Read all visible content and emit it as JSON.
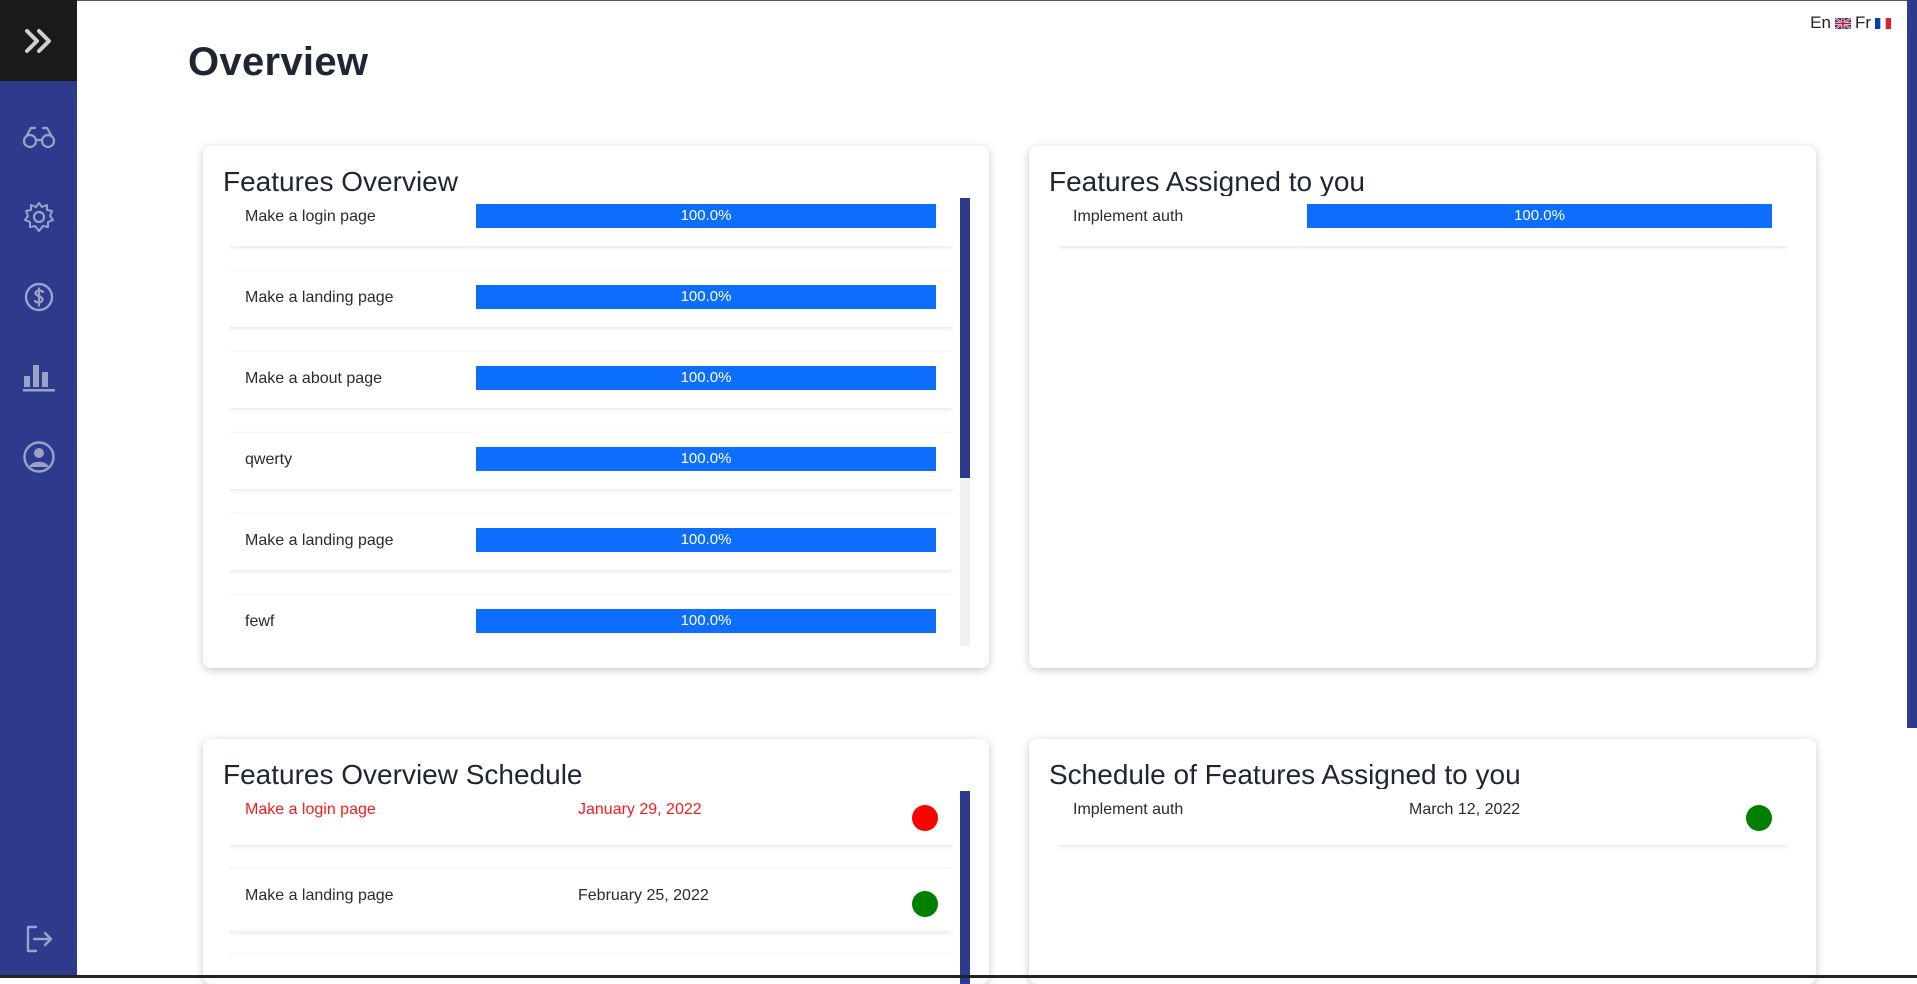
{
  "page": {
    "title": "Overview"
  },
  "language": {
    "en_label": "En",
    "fr_label": "Fr"
  },
  "sidebar": {
    "toggle_icon": "double-chevron-right-icon",
    "items": [
      {
        "icon": "binoculars-icon"
      },
      {
        "icon": "gear-icon"
      },
      {
        "icon": "dollar-circle-icon"
      },
      {
        "icon": "bar-chart-icon"
      },
      {
        "icon": "user-circle-icon"
      }
    ],
    "logout_icon": "logout-icon"
  },
  "features_overview": {
    "title": "Features Overview",
    "items": [
      {
        "name": "Make a login page",
        "progress": 100,
        "progress_label": "100.0%"
      },
      {
        "name": "Make a landing page",
        "progress": 100,
        "progress_label": "100.0%"
      },
      {
        "name": "Make a about page",
        "progress": 100,
        "progress_label": "100.0%"
      },
      {
        "name": "qwerty",
        "progress": 100,
        "progress_label": "100.0%"
      },
      {
        "name": "Make a landing page",
        "progress": 100,
        "progress_label": "100.0%"
      },
      {
        "name": "fewf",
        "progress": 100,
        "progress_label": "100.0%"
      }
    ]
  },
  "features_assigned": {
    "title": "Features Assigned to you",
    "items": [
      {
        "name": "Implement auth",
        "progress": 100,
        "progress_label": "100.0%"
      }
    ]
  },
  "overview_schedule": {
    "title": "Features Overview Schedule",
    "items": [
      {
        "name": "Make a login page",
        "date": "January 29, 2022",
        "status": "late",
        "status_color": "#ff0000"
      },
      {
        "name": "Make a landing page",
        "date": "February 25, 2022",
        "status": "on-time",
        "status_color": "#008000"
      }
    ]
  },
  "assigned_schedule": {
    "title": "Schedule of Features Assigned to you",
    "items": [
      {
        "name": "Implement auth",
        "date": "March 12, 2022",
        "status": "on-time",
        "status_color": "#008000"
      }
    ]
  },
  "colors": {
    "sidebar": "#2e3a8c",
    "progress": "#0d6efd",
    "late": "#ff0000",
    "on_time": "#008000"
  }
}
